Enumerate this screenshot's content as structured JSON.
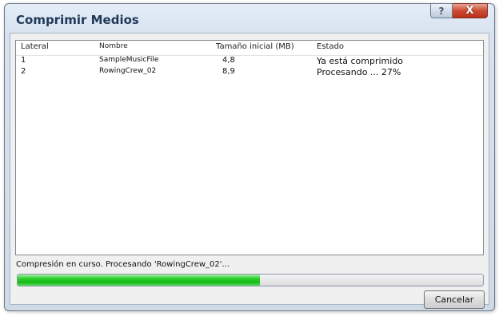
{
  "window": {
    "title": "Comprimir Medios",
    "help_glyph": "?",
    "close_glyph": "X"
  },
  "table": {
    "headers": [
      "Lateral",
      "Nombre",
      "Tamaño inicial (MB)",
      "Estado"
    ],
    "rows": [
      {
        "lateral": "1",
        "nombre": "SampleMusicFile",
        "size": "4,8",
        "estado": "Ya está comprimido"
      },
      {
        "lateral": "2",
        "nombre": "RowingCrew_02",
        "size": "8,9",
        "estado": "Procesando ... 27%"
      }
    ]
  },
  "status": {
    "text": "Compresión en curso. Procesando 'RowingCrew_02'..."
  },
  "progress": {
    "fraction": 0.52,
    "color": "#22c422"
  },
  "buttons": {
    "cancel": "Cancelar"
  }
}
